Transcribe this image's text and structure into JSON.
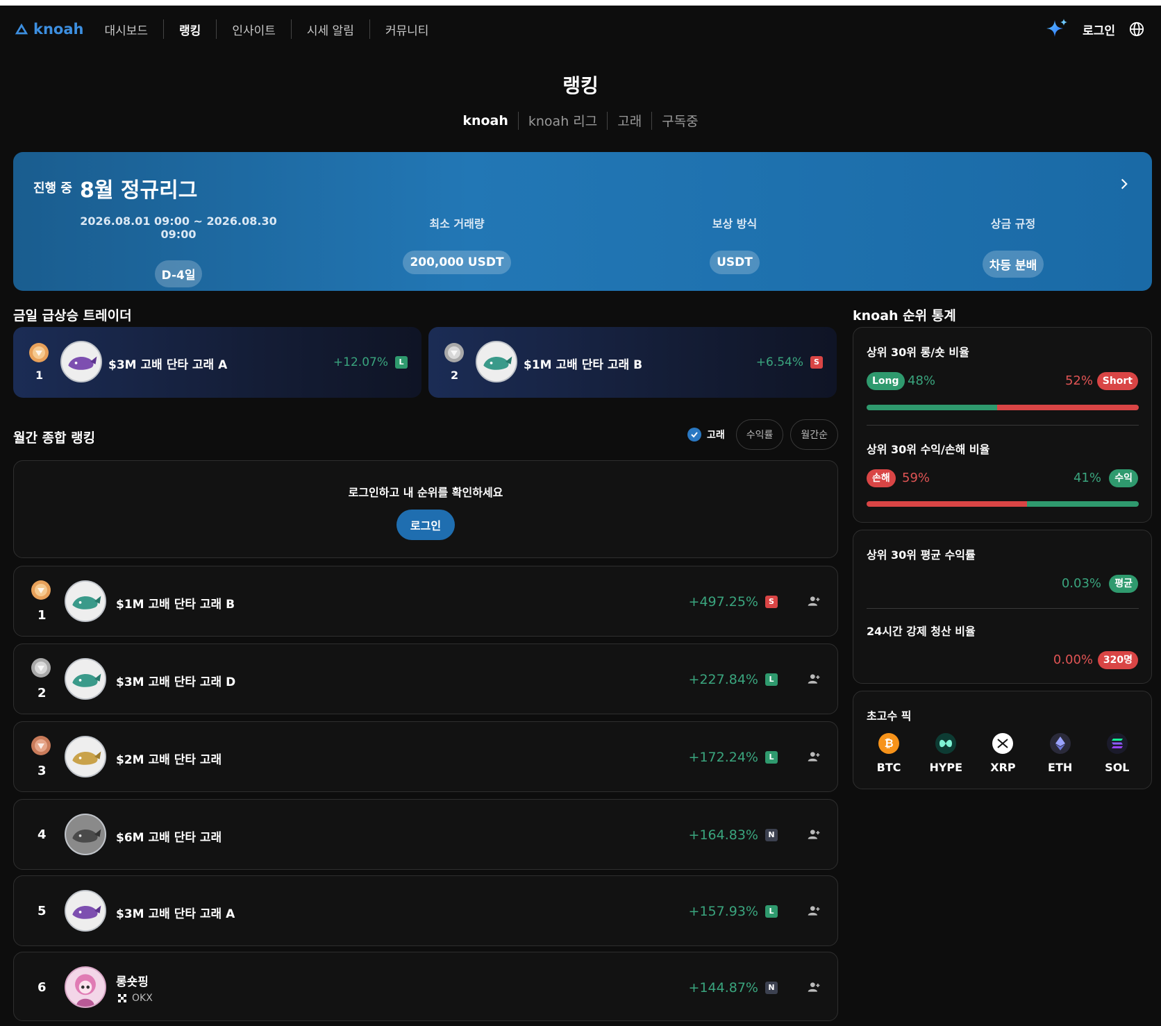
{
  "nav": {
    "logo_text": "knoah",
    "items": [
      {
        "label": "대시보드",
        "active": false
      },
      {
        "label": "랭킹",
        "active": true
      },
      {
        "label": "인사이트",
        "active": false
      },
      {
        "label": "시세 알림",
        "active": false
      },
      {
        "label": "커뮤니티",
        "active": false
      }
    ],
    "login_label": "로그인"
  },
  "header": {
    "title": "랭킹",
    "tabs": [
      {
        "label": "knoah",
        "active": true
      },
      {
        "label": "knoah 리그",
        "active": false
      },
      {
        "label": "고래",
        "active": false
      },
      {
        "label": "구독중",
        "active": false
      }
    ]
  },
  "banner": {
    "status": "진행 중",
    "title": "8월 정규리그",
    "columns": [
      {
        "label": "2026.08.01 09:00 ~ 2026.08.30 09:00",
        "value": "D-4일"
      },
      {
        "label": "최소 거래량",
        "value": "200,000 USDT"
      },
      {
        "label": "보상 방식",
        "value": "USDT"
      },
      {
        "label": "상금 규정",
        "value": "차등 분배"
      }
    ]
  },
  "risers": {
    "title": "금일 급상승 트레이더",
    "items": [
      {
        "rank": "1",
        "name": "$3M 고배 단타 고래 A",
        "pct": "+12.07%",
        "tag": "L"
      },
      {
        "rank": "2",
        "name": "$1M 고배 단타 고래 B",
        "pct": "+6.54%",
        "tag": "S"
      }
    ]
  },
  "monthly": {
    "title": "월간 종합 랭킹",
    "filter_whale": "고래",
    "filter_return": "수익률",
    "filter_month": "월간순",
    "login_msg": "로그인하고 내 순위를 확인하세요",
    "login_button": "로그인",
    "rows": [
      {
        "rank": "1",
        "name": "$1M 고배 단타 고래 B",
        "pct": "+497.25%",
        "tag": "S"
      },
      {
        "rank": "2",
        "name": "$3M 고배 단타 고래 D",
        "pct": "+227.84%",
        "tag": "L"
      },
      {
        "rank": "3",
        "name": "$2M 고배 단타 고래",
        "pct": "+172.24%",
        "tag": "L"
      },
      {
        "rank": "4",
        "name": "$6M 고배 단타 고래",
        "pct": "+164.83%",
        "tag": "N"
      },
      {
        "rank": "5",
        "name": "$3M 고배 단타 고래 A",
        "pct": "+157.93%",
        "tag": "L"
      },
      {
        "rank": "6",
        "name": "롱숏핑",
        "exchange": "OKX",
        "pct": "+144.87%",
        "tag": "N"
      }
    ]
  },
  "stats": {
    "title": "knoah 순위 통계",
    "long_short": {
      "label": "상위 30위 롱/숏 비율",
      "long_label": "Long",
      "long_pct": "48%",
      "long_value": 48,
      "short_label": "Short",
      "short_pct": "52%"
    },
    "profit_loss": {
      "label": "상위 30위 수익/손해 비율",
      "loss_label": "손해",
      "loss_pct": "59%",
      "loss_value": 59,
      "profit_label": "수익",
      "profit_pct": "41%"
    },
    "avg_return": {
      "label": "상위 30위 평균 수익률",
      "value": "0.03%",
      "badge": "평균"
    },
    "liquidation": {
      "label": "24시간 강제 청산 비율",
      "value": "0.00%",
      "badge": "320명"
    }
  },
  "picks": {
    "title": "초고수 픽",
    "coins": [
      {
        "symbol": "BTC",
        "icon": "bitcoin-icon",
        "color": "#f7931a"
      },
      {
        "symbol": "HYPE",
        "icon": "hype-icon",
        "color": "#0d3b33"
      },
      {
        "symbol": "XRP",
        "icon": "xrp-icon",
        "color": "#ffffff"
      },
      {
        "symbol": "ETH",
        "icon": "ethereum-icon",
        "color": "#2a2a3a"
      },
      {
        "symbol": "SOL",
        "icon": "solana-icon",
        "color": "#1b1b2b"
      }
    ]
  },
  "colors": {
    "accent": "#2a78c2",
    "positive": "#3aa57e",
    "negative": "#d94545",
    "bar_green": "#2f9a6e",
    "bar_red": "#d94545"
  }
}
